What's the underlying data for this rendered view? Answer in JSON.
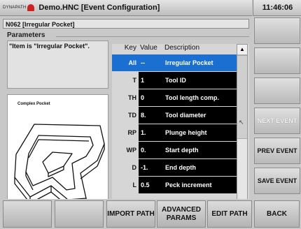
{
  "titlebar": {
    "logo_text": "DYNAPATH",
    "title": "Demo.HNC    [Event Configuration]"
  },
  "clock": "11:46:06",
  "path_name": "N062 [Irregular Pocket]",
  "params_section": {
    "title": "Parameters"
  },
  "message": "\"Item is \"Irregular Pocket\".",
  "image": {
    "caption": "Complex Pocket"
  },
  "table": {
    "headers": {
      "key": "Key",
      "value": "Value",
      "description": "Description"
    },
    "rows": [
      {
        "key": "All",
        "value": "--",
        "description": "Irregular Pocket",
        "selected": true
      },
      {
        "key": "T",
        "value": "1",
        "description": "Tool ID"
      },
      {
        "key": "TH",
        "value": "0",
        "description": "Tool length comp."
      },
      {
        "key": "TD",
        "value": "8.",
        "description": "Tool diameter"
      },
      {
        "key": "RP",
        "value": "1.",
        "description": "Plunge height"
      },
      {
        "key": "WP",
        "value": "0.",
        "description": "Start depth"
      },
      {
        "key": "D",
        "value": "-1.",
        "description": "End depth"
      },
      {
        "key": "L",
        "value": "0.5",
        "description": "Peck increment"
      }
    ]
  },
  "side_buttons": [
    "",
    "",
    "",
    "NEXT EVENT",
    "PREV EVENT",
    "SAVE EVENT"
  ],
  "bottom_buttons": [
    "",
    "",
    "IMPORT PATH",
    "ADVANCED PARAMS",
    "EDIT PATH",
    "BACK"
  ],
  "colors": {
    "selected_row": "#1a6fd1",
    "value_cell_bg": "#000000",
    "logo_red": "#cc2222"
  }
}
